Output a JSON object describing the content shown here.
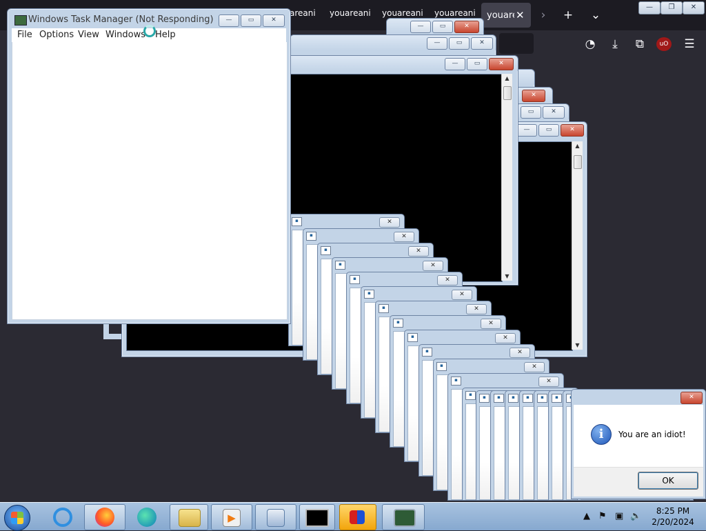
{
  "firefox": {
    "tabs": [
      "areani",
      "youareani",
      "youareani",
      "youareani"
    ],
    "active_tab": {
      "label": "youarea",
      "close": "✕"
    },
    "buttons": {
      "forward": "›",
      "new_tab": "+",
      "list_tabs": "⌄",
      "pocket": "◔",
      "downloads": "⤓",
      "extensions": "⧉",
      "ublock": "uO",
      "menu": "☰"
    },
    "window_buttons": {
      "minimize": "—",
      "restore": "❐",
      "close": "✕"
    }
  },
  "task_manager": {
    "title": "Windows Task Manager (Not Responding)",
    "menu": [
      "File",
      "Options",
      "View",
      "Windows",
      "Help"
    ],
    "buttons": {
      "minimize": "—",
      "maximize": "▭",
      "close": "✕"
    }
  },
  "stacked_windows": {
    "buttons": {
      "minimize": "—",
      "maximize": "▭",
      "close": "✕"
    },
    "scroll_up": "▲",
    "scroll_down": "▼"
  },
  "popups": {
    "icon": "▪",
    "close": "✕"
  },
  "message_box": {
    "text": "You are an idiot!",
    "ok": "OK",
    "info_icon": "i",
    "close": "✕"
  },
  "taskbar": {
    "clock_time": "8:25 PM",
    "clock_date": "2/20/2024",
    "tray": {
      "show_hidden": "▲",
      "flag": "⚑",
      "network": "▣",
      "volume": "🔈"
    },
    "apps": [
      "start-orb",
      "internet-explorer-icon",
      "firefox-icon",
      "edge-icon",
      "file-explorer-icon",
      "media-player-icon",
      "installer-icon",
      "command-prompt-icon",
      "paint-3d-icon",
      "task-manager-icon"
    ]
  },
  "colors": {
    "accent": "#c8452e",
    "desktop": "#2b2a33",
    "taskbar": "#86a8cf"
  }
}
